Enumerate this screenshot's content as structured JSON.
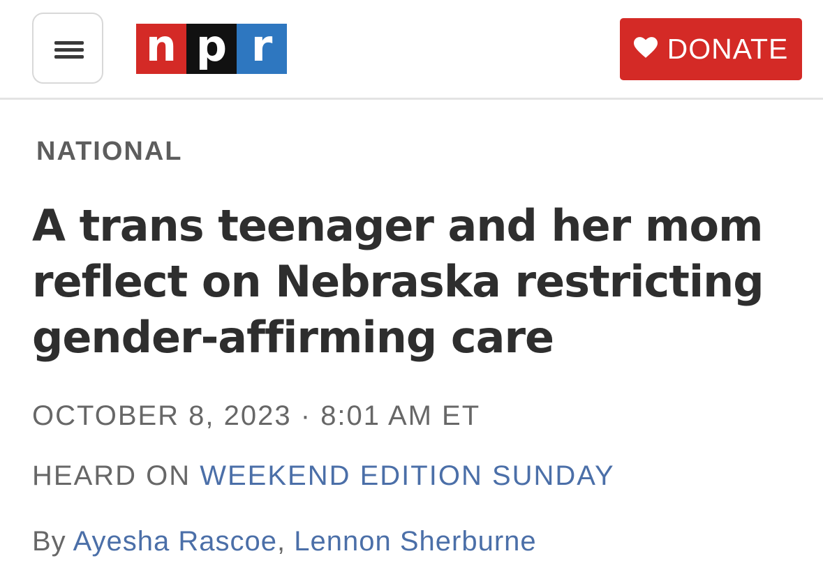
{
  "header": {
    "logo": {
      "letters": [
        "n",
        "p",
        "r"
      ],
      "colors": [
        "#d42a26",
        "#111111",
        "#2e77c0"
      ]
    },
    "menu_icon": "hamburger-menu-icon",
    "donate": {
      "icon": "heart-icon",
      "label": "DONATE",
      "color": "#d42a26"
    }
  },
  "article": {
    "section": "NATIONAL",
    "headline": "A trans teenager and her mom reflect on Nebraska restricting gender-affirming care",
    "date": "OCTOBER 8, 2023",
    "separator": " · ",
    "time": "8:01 AM ET",
    "heard_on_label": "HEARD ON ",
    "heard_on_program": "WEEKEND EDITION SUNDAY",
    "byline_prefix": "By ",
    "authors": [
      "Ayesha Rascoe",
      "Lennon Sherburne"
    ],
    "author_separator": ", ",
    "link_color": "#4b6fa8"
  }
}
